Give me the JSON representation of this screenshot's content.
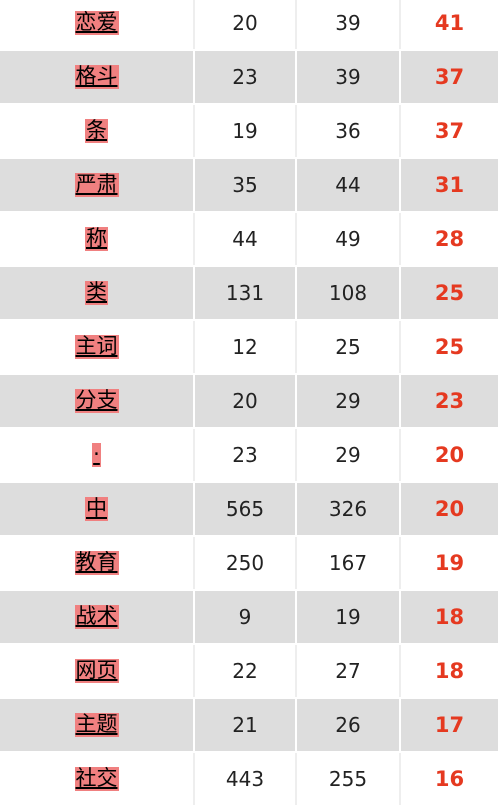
{
  "table": {
    "rows": [
      {
        "word": "恋爱",
        "a": "20",
        "b": "39",
        "score": "41"
      },
      {
        "word": "格斗",
        "a": "23",
        "b": "39",
        "score": "37"
      },
      {
        "word": "条",
        "a": "19",
        "b": "36",
        "score": "37"
      },
      {
        "word": "严肃",
        "a": "35",
        "b": "44",
        "score": "31"
      },
      {
        "word": "称",
        "a": "44",
        "b": "49",
        "score": "28"
      },
      {
        "word": "类",
        "a": "131",
        "b": "108",
        "score": "25"
      },
      {
        "word": "主词",
        "a": "12",
        "b": "25",
        "score": "25"
      },
      {
        "word": "分支",
        "a": "20",
        "b": "29",
        "score": "23"
      },
      {
        "word": "·",
        "a": "23",
        "b": "29",
        "score": "20"
      },
      {
        "word": "中",
        "a": "565",
        "b": "326",
        "score": "20"
      },
      {
        "word": "教育",
        "a": "250",
        "b": "167",
        "score": "19"
      },
      {
        "word": "战术",
        "a": "9",
        "b": "19",
        "score": "18"
      },
      {
        "word": "网页",
        "a": "22",
        "b": "27",
        "score": "18"
      },
      {
        "word": "主题",
        "a": "21",
        "b": "26",
        "score": "17"
      },
      {
        "word": "社交",
        "a": "443",
        "b": "255",
        "score": "16"
      }
    ]
  },
  "colors": {
    "row_alt": "#dddddd",
    "word_highlight": "#f08080",
    "score": "#e53920"
  }
}
